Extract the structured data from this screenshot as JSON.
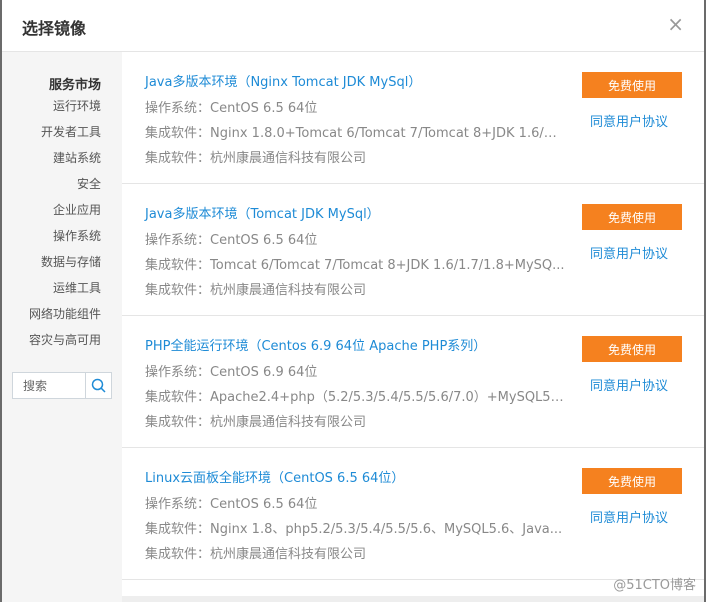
{
  "dialog": {
    "title": "选择镜像",
    "close_symbol": "×"
  },
  "sidebar": {
    "title": "服务市场",
    "items": [
      {
        "label": "运行环境"
      },
      {
        "label": "开发者工具"
      },
      {
        "label": "建站系统"
      },
      {
        "label": "安全"
      },
      {
        "label": "企业应用"
      },
      {
        "label": "操作系统"
      },
      {
        "label": "数据与存储"
      },
      {
        "label": "运维工具"
      },
      {
        "label": "网络功能组件"
      },
      {
        "label": "容灾与高可用"
      }
    ],
    "search": {
      "placeholder": "搜索",
      "value": ""
    }
  },
  "images": [
    {
      "title": "Java多版本环境（Nginx Tomcat JDK MySql）",
      "os_label": "操作系统：",
      "os_value": "CentOS 6.5 64位",
      "software_label": "集成软件：",
      "software_value": "Nginx 1.8.0+Tomcat 6/Tomcat 7/Tomcat 8+JDK 1.6/1....",
      "vendor_label": "集成软件：",
      "vendor_value": "杭州康晨通信科技有限公司",
      "button_label": "免费使用",
      "agreement_label": "同意用户协议"
    },
    {
      "title": "Java多版本环境（Tomcat JDK MySql）",
      "os_label": "操作系统：",
      "os_value": "CentOS 6.5 64位",
      "software_label": "集成软件：",
      "software_value": "Tomcat 6/Tomcat 7/Tomcat 8+JDK 1.6/1.7/1.8+MySQ...",
      "vendor_label": "集成软件：",
      "vendor_value": "杭州康晨通信科技有限公司",
      "button_label": "免费使用",
      "agreement_label": "同意用户协议"
    },
    {
      "title": "PHP全能运行环境（Centos 6.9 64位 Apache PHP系列）",
      "os_label": "操作系统：",
      "os_value": "CentOS 6.9 64位",
      "software_label": "集成软件：",
      "software_value": "Apache2.4+php（5.2/5.3/5.4/5.5/5.6/7.0）+MySQL5....",
      "vendor_label": "集成软件：",
      "vendor_value": "杭州康晨通信科技有限公司",
      "button_label": "免费使用",
      "agreement_label": "同意用户协议"
    },
    {
      "title": "Linux云面板全能环境（CentOS 6.5 64位）",
      "os_label": "操作系统：",
      "os_value": "CentOS 6.5 64位",
      "software_label": "集成软件：",
      "software_value": "Nginx 1.8、php5.2/5.3/5.4/5.5/5.6、MySQL5.6、Java...",
      "vendor_label": "集成软件：",
      "vendor_value": "杭州康晨通信科技有限公司",
      "button_label": "免费使用",
      "agreement_label": "同意用户协议"
    }
  ],
  "watermark": "@51CTO博客",
  "colors": {
    "accent_orange": "#f5811f",
    "link_blue": "#1e8bd6"
  }
}
